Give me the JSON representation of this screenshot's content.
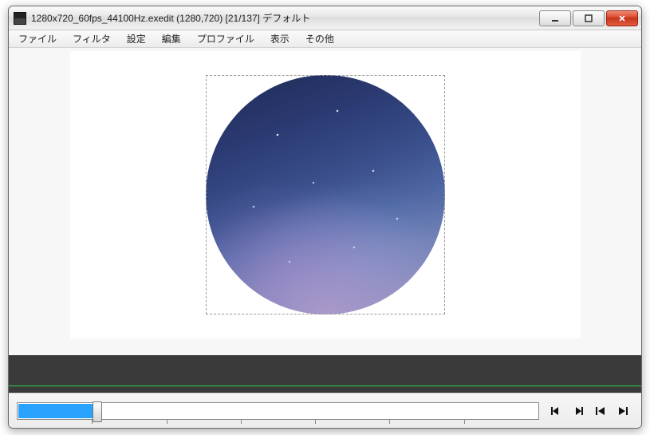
{
  "window": {
    "title": "1280x720_60fps_44100Hz.exedit (1280,720) [21/137] デフォルト"
  },
  "menu": {
    "file": "ファイル",
    "filter": "フィルタ",
    "settings": "設定",
    "edit": "編集",
    "profile": "プロファイル",
    "view": "表示",
    "other": "その他"
  },
  "timeline": {
    "current_frame": 21,
    "total_frames": 137,
    "seek_percent": 15.3
  },
  "colors": {
    "seek_fill": "#2aa3ff",
    "waveform_line": "#2fd14a"
  }
}
